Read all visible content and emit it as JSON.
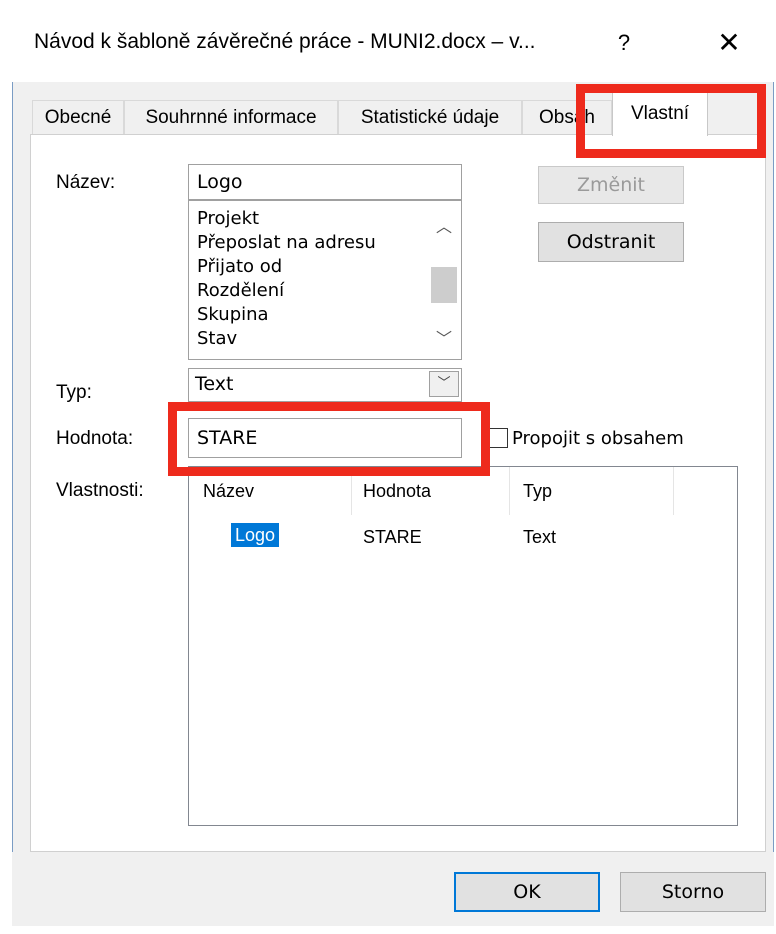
{
  "window": {
    "title": "Návod k šabloně závěrečné práce - MUNI2.docx – v...",
    "help_label": "?",
    "close_label": "✕"
  },
  "tabs": [
    {
      "label": "Obecné"
    },
    {
      "label": "Souhrnné informace"
    },
    {
      "label": "Statistické údaje"
    },
    {
      "label": "Obsah"
    },
    {
      "label": "Vlastní"
    }
  ],
  "form": {
    "name_label": "Název:",
    "name_value": "Logo",
    "name_options": [
      "Projekt",
      "Přeposlat na adresu",
      "Přijato od",
      "Rozdělení",
      "Skupina",
      "Stav"
    ],
    "type_label": "Typ:",
    "type_value": "Text",
    "value_label": "Hodnota:",
    "value_value": "STARE",
    "link_label": "Propojit s obsahem",
    "link_checked": false,
    "change_button": "Změnit",
    "remove_button": "Odstranit",
    "properties_label": "Vlastnosti:"
  },
  "properties_table": {
    "headers": [
      "Název",
      "Hodnota",
      "Typ"
    ],
    "rows": [
      {
        "name": "Logo",
        "value": "STARE",
        "type": "Text"
      }
    ]
  },
  "footer": {
    "ok": "OK",
    "cancel": "Storno"
  },
  "colors": {
    "highlight": "#ee2a1c",
    "selection": "#0078d7"
  }
}
